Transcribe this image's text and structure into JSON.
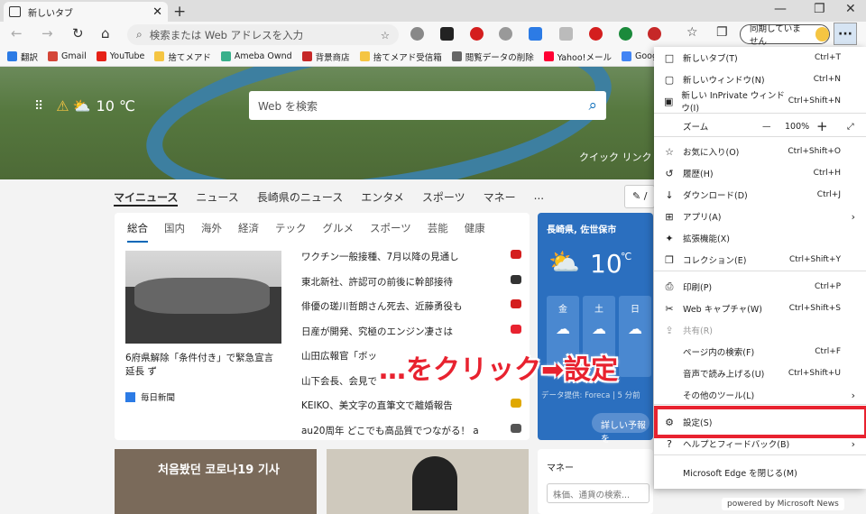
{
  "tab": {
    "title": "新しいタブ"
  },
  "address": {
    "placeholder": "検索または Web アドレスを入力"
  },
  "sync": {
    "label": "同期していません"
  },
  "favorites": [
    {
      "label": "翻訳",
      "color": "#2c7be5"
    },
    {
      "label": "Gmail",
      "color": "#d44638"
    },
    {
      "label": "YouTube",
      "color": "#e62117"
    },
    {
      "label": "捨てメアド",
      "color": "#f5c542"
    },
    {
      "label": "Ameba Ownd",
      "color": "#39b08b"
    },
    {
      "label": "背景商店",
      "color": "#c62828"
    },
    {
      "label": "捨てメアド受信箱",
      "color": "#f5c542"
    },
    {
      "label": "閲覧データの削除",
      "color": "#666666"
    },
    {
      "label": "Yahoo!メール",
      "color": "#ff0033"
    },
    {
      "label": "Google",
      "color": "#4285f4"
    }
  ],
  "weather": {
    "temp": "10 ℃"
  },
  "search": {
    "placeholder": "Web を検索"
  },
  "quick_link": "クイック リンク",
  "nav_tabs": [
    "マイニュース",
    "ニュース",
    "長崎県のニュース",
    "エンタメ",
    "スポーツ",
    "マネー",
    "..."
  ],
  "sub_tabs": [
    "総合",
    "国内",
    "海外",
    "経済",
    "テック",
    "グルメ",
    "スポーツ",
    "芸能",
    "健康"
  ],
  "feature": {
    "headline": "6府県解除「条件付き」で緊急宣言 延長 ず",
    "source": "毎日新聞"
  },
  "news_items": [
    {
      "title": "ワクチン一般接種、7月以降の見通し",
      "badge": "#d41e1e"
    },
    {
      "title": "東北新社、許認可の前後に幹部接待",
      "badge": "#333333"
    },
    {
      "title": "俳優の瑳川哲朗さん死去、近藤勇役も",
      "badge": "#d41e1e"
    },
    {
      "title": "日産が開発、究極のエンジン凄さは",
      "badge": "#e8222f"
    },
    {
      "title": "山田広報官「ボッ",
      "badge": ""
    },
    {
      "title": "山下会長、会見で",
      "badge": ""
    },
    {
      "title": "KEIKO、美文字の直筆文で離婚報告",
      "badge": "#e0a800"
    },
    {
      "title": "au20周年 どこでも高品質でつながる！ a",
      "badge": "#555555"
    }
  ],
  "weather_card": {
    "location": "長崎県, 佐世保市",
    "temp": "10",
    "unit": "℃",
    "days": [
      "金",
      "土",
      "日"
    ],
    "source": "データ提供: Foreca | 5 分前",
    "button": "詳しい予報を"
  },
  "overlay_text": "…をクリック➡設定",
  "money": {
    "label": "マネー",
    "placeholder": "株価、通貨の検索..."
  },
  "menu": {
    "items": [
      {
        "icon": "□",
        "label": "新しいタブ(T)",
        "shortcut": "Ctrl+T"
      },
      {
        "icon": "▢",
        "label": "新しいウィンドウ(N)",
        "shortcut": "Ctrl+N"
      },
      {
        "icon": "▣",
        "label": "新しい InPrivate ウィンドウ(I)",
        "shortcut": "Ctrl+Shift+N"
      },
      {
        "icon": "☆",
        "label": "お気に入り(O)",
        "shortcut": "Ctrl+Shift+O"
      },
      {
        "icon": "↺",
        "label": "履歴(H)",
        "shortcut": "Ctrl+H"
      },
      {
        "icon": "↓",
        "label": "ダウンロード(D)",
        "shortcut": "Ctrl+J"
      },
      {
        "icon": "⊞",
        "label": "アプリ(A)",
        "shortcut": "",
        "arrow": true
      },
      {
        "icon": "✦",
        "label": "拡張機能(X)",
        "shortcut": ""
      },
      {
        "icon": "❐",
        "label": "コレクション(E)",
        "shortcut": "Ctrl+Shift+Y"
      },
      {
        "icon": "⎙",
        "label": "印刷(P)",
        "shortcut": "Ctrl+P"
      },
      {
        "icon": "✂",
        "label": "Web キャプチャ(W)",
        "shortcut": "Ctrl+Shift+S"
      },
      {
        "icon": "⇪",
        "label": "共有(R)",
        "shortcut": "",
        "disabled": true
      },
      {
        "icon": "",
        "label": "ページ内の検索(F)",
        "shortcut": "Ctrl+F"
      },
      {
        "icon": "",
        "label": "音声で読み上げる(U)",
        "shortcut": "Ctrl+Shift+U"
      },
      {
        "icon": "",
        "label": "その他のツール(L)",
        "shortcut": "",
        "arrow": true
      },
      {
        "icon": "⚙",
        "label": "設定(S)",
        "shortcut": ""
      },
      {
        "icon": "?",
        "label": "ヘルプとフィードバック(B)",
        "shortcut": "",
        "arrow": true
      },
      {
        "icon": "",
        "label": "Microsoft Edge を閉じる(M)",
        "shortcut": ""
      }
    ],
    "zoom": {
      "label": "ズーム",
      "value": "100%"
    }
  },
  "powered": "powered by Microsoft News",
  "colors": {
    "accent": "#0067b8",
    "highlight": "#e8222f"
  }
}
